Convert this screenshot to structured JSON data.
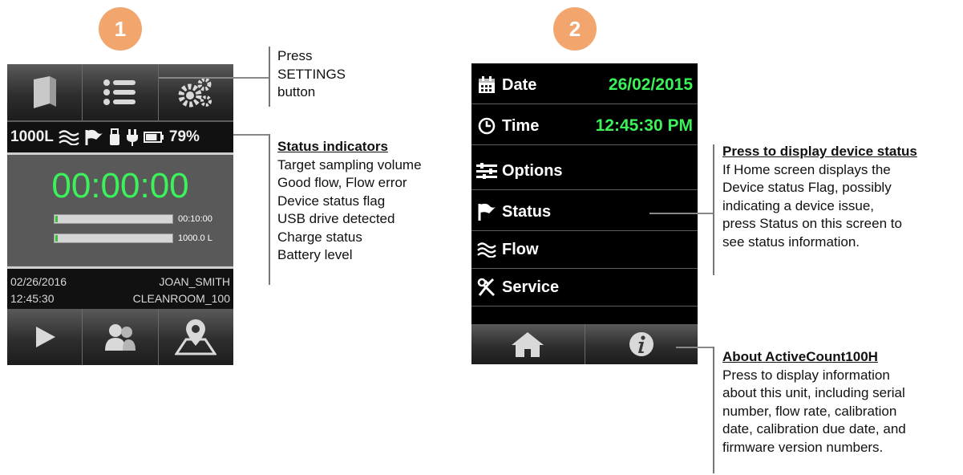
{
  "step1": {
    "number": "1"
  },
  "step2": {
    "number": "2"
  },
  "device1": {
    "toolbar": {
      "icons": [
        "book-icon",
        "list-icon",
        "gears-icon"
      ]
    },
    "status_bar": {
      "volume": "1000L",
      "battery_percent": "79%",
      "battery_level": 0.79,
      "icons": [
        "flow-icon",
        "flag-icon",
        "usb-icon",
        "plug-icon",
        "battery-icon"
      ]
    },
    "timer": "00:00:00",
    "progress": [
      {
        "label": "00:10:00",
        "fraction": 0.02
      },
      {
        "label": "1000.0 L",
        "fraction": 0.02
      }
    ],
    "info": {
      "date": "02/26/2016",
      "user": "JOAN_SMITH",
      "time": "12:45:30",
      "location": "CLEANROOM_100"
    },
    "bottom_bar": {
      "icons": [
        "play-icon",
        "users-icon",
        "location-icon"
      ]
    }
  },
  "device2": {
    "menu": [
      {
        "label": "Date",
        "value": "26/02/2015",
        "icon": "calendar-icon"
      },
      {
        "label": "Time",
        "value": "12:45:30 PM",
        "icon": "clock-icon"
      },
      {
        "label": "Options",
        "icon": "sliders-icon"
      },
      {
        "label": "Status",
        "icon": "flag-icon"
      },
      {
        "label": "Flow",
        "icon": "flow-icon"
      },
      {
        "label": "Service",
        "icon": "tools-icon"
      }
    ],
    "bottom_bar": {
      "icons": [
        "home-icon",
        "info-icon"
      ]
    }
  },
  "callouts": {
    "settings": {
      "lines": [
        "Press",
        "SETTINGS",
        "button"
      ]
    },
    "status_indicators": {
      "heading": "Status indicators",
      "lines": [
        "Target sampling volume",
        "Good flow, Flow error",
        "Device status flag",
        "USB drive detected",
        "Charge status",
        "Battery level"
      ]
    },
    "device_status": {
      "heading": "Press to display device status",
      "lines": [
        "If Home screen displays the",
        "Device status Flag, possibly",
        "indicating a device issue,",
        "press Status on this screen to",
        "see status information."
      ]
    },
    "about": {
      "heading": "About ActiveCount100H",
      "lines": [
        "Press to display information",
        "about this unit, including serial",
        "number, flow rate, calibration",
        "date, calibration due date, and",
        "firmware version numbers."
      ]
    }
  },
  "colors": {
    "badge": "#f2a66e",
    "green_text": "#3bf25a",
    "device_bg": "#5d5d5d"
  }
}
